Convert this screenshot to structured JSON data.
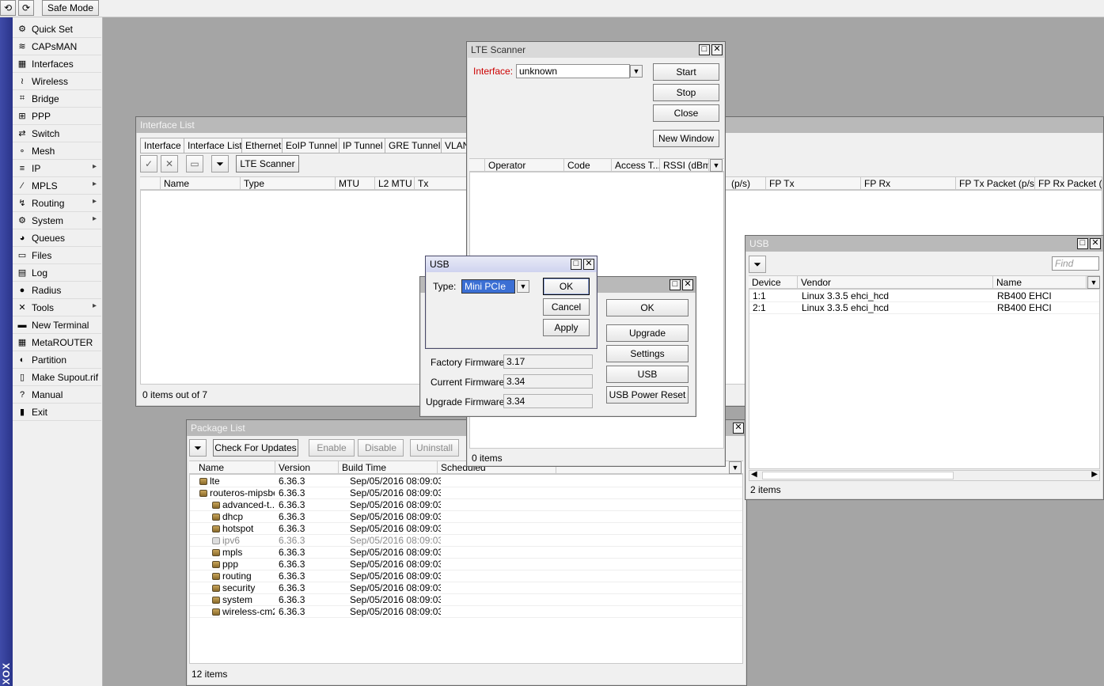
{
  "topbar": {
    "undo": "⟲",
    "redo": "⟳",
    "safe_mode": "Safe Mode"
  },
  "strip_label": "XOX",
  "sidebar": {
    "items": [
      {
        "label": "Quick Set",
        "icon": "⚙",
        "sub": false
      },
      {
        "label": "CAPsMAN",
        "icon": "≋",
        "sub": false
      },
      {
        "label": "Interfaces",
        "icon": "▦",
        "sub": false
      },
      {
        "label": "Wireless",
        "icon": "≀",
        "sub": false
      },
      {
        "label": "Bridge",
        "icon": "⌗",
        "sub": false
      },
      {
        "label": "PPP",
        "icon": "⊞",
        "sub": false
      },
      {
        "label": "Switch",
        "icon": "⇄",
        "sub": false
      },
      {
        "label": "Mesh",
        "icon": "∘",
        "sub": false
      },
      {
        "label": "IP",
        "icon": "≡",
        "sub": true
      },
      {
        "label": "MPLS",
        "icon": "⁄",
        "sub": true
      },
      {
        "label": "Routing",
        "icon": "↯",
        "sub": true
      },
      {
        "label": "System",
        "icon": "⚙",
        "sub": true
      },
      {
        "label": "Queues",
        "icon": "◕",
        "sub": false
      },
      {
        "label": "Files",
        "icon": "▭",
        "sub": false
      },
      {
        "label": "Log",
        "icon": "▤",
        "sub": false
      },
      {
        "label": "Radius",
        "icon": "●",
        "sub": false
      },
      {
        "label": "Tools",
        "icon": "✕",
        "sub": true
      },
      {
        "label": "New Terminal",
        "icon": "▬",
        "sub": false
      },
      {
        "label": "MetaROUTER",
        "icon": "▦",
        "sub": false
      },
      {
        "label": "Partition",
        "icon": "◐",
        "sub": false
      },
      {
        "label": "Make Supout.rif",
        "icon": "▯",
        "sub": false
      },
      {
        "label": "Manual",
        "icon": "?",
        "sub": false
      },
      {
        "label": "Exit",
        "icon": "▮",
        "sub": false
      }
    ]
  },
  "interface_list": {
    "title": "Interface List",
    "tabs": [
      "Interface",
      "Interface List",
      "Ethernet",
      "EoIP Tunnel",
      "IP Tunnel",
      "GRE Tunnel",
      "VLAN"
    ],
    "lte_scanner_btn": "LTE Scanner",
    "columns": [
      "Name",
      "Type",
      "MTU",
      "L2 MTU",
      "Tx"
    ],
    "right_columns": [
      "(p/s)",
      "FP Tx",
      "FP Rx",
      "FP Tx Packet (p/s)",
      "FP Rx Packet (p/s)"
    ],
    "status": "0 items out of 7"
  },
  "lte_scanner": {
    "title": "LTE Scanner",
    "interface_label": "Interface:",
    "interface_value": "unknown",
    "start": "Start",
    "stop": "Stop",
    "close": "Close",
    "new_window": "New Window",
    "columns": [
      "Operator",
      "Code",
      "Access T...",
      "RSSI (dBm)"
    ],
    "status": "0 items"
  },
  "lte_dialog": {
    "ok": "OK",
    "upgrade": "Upgrade",
    "settings": "Settings",
    "usb": "USB",
    "usb_power_reset": "USB Power Reset",
    "factory_label": "Factory Firmware:",
    "factory_value": "3.17",
    "current_label": "Current Firmware:",
    "current_value": "3.34",
    "upgrade_label": "Upgrade Firmware:",
    "upgrade_value": "3.34"
  },
  "usb_small": {
    "title": "USB",
    "type_label": "Type:",
    "type_value": "Mini PCIe",
    "ok": "OK",
    "cancel": "Cancel",
    "apply": "Apply"
  },
  "usb_list": {
    "title": "USB",
    "find_placeholder": "Find",
    "columns": [
      "Device",
      "Vendor",
      "Name"
    ],
    "rows": [
      {
        "device": "1:1",
        "vendor": "Linux 3.3.5 ehci_hcd",
        "name": "RB400 EHCI"
      },
      {
        "device": "2:1",
        "vendor": "Linux 3.3.5 ehci_hcd",
        "name": "RB400 EHCI"
      }
    ],
    "status": "2 items"
  },
  "package_list": {
    "title": "Package List",
    "check_updates": "Check For Updates",
    "enable": "Enable",
    "disable": "Disable",
    "uninstall": "Uninstall",
    "columns": [
      "Name",
      "Version",
      "Build Time",
      "Scheduled"
    ],
    "rows": [
      {
        "name": "lte",
        "version": "6.36.3",
        "build": "Sep/05/2016 08:09:03",
        "indent": 0,
        "disabled": false
      },
      {
        "name": "routeros-mipsbe",
        "version": "6.36.3",
        "build": "Sep/05/2016 08:09:03",
        "indent": 0,
        "disabled": false
      },
      {
        "name": "advanced-t...",
        "version": "6.36.3",
        "build": "Sep/05/2016 08:09:03",
        "indent": 1,
        "disabled": false
      },
      {
        "name": "dhcp",
        "version": "6.36.3",
        "build": "Sep/05/2016 08:09:03",
        "indent": 1,
        "disabled": false
      },
      {
        "name": "hotspot",
        "version": "6.36.3",
        "build": "Sep/05/2016 08:09:03",
        "indent": 1,
        "disabled": false
      },
      {
        "name": "ipv6",
        "version": "6.36.3",
        "build": "Sep/05/2016 08:09:03",
        "indent": 1,
        "disabled": true
      },
      {
        "name": "mpls",
        "version": "6.36.3",
        "build": "Sep/05/2016 08:09:03",
        "indent": 1,
        "disabled": false
      },
      {
        "name": "ppp",
        "version": "6.36.3",
        "build": "Sep/05/2016 08:09:03",
        "indent": 1,
        "disabled": false
      },
      {
        "name": "routing",
        "version": "6.36.3",
        "build": "Sep/05/2016 08:09:03",
        "indent": 1,
        "disabled": false
      },
      {
        "name": "security",
        "version": "6.36.3",
        "build": "Sep/05/2016 08:09:03",
        "indent": 1,
        "disabled": false
      },
      {
        "name": "system",
        "version": "6.36.3",
        "build": "Sep/05/2016 08:09:03",
        "indent": 1,
        "disabled": false
      },
      {
        "name": "wireless-cm2",
        "version": "6.36.3",
        "build": "Sep/05/2016 08:09:03",
        "indent": 1,
        "disabled": false
      }
    ],
    "status": "12 items"
  }
}
